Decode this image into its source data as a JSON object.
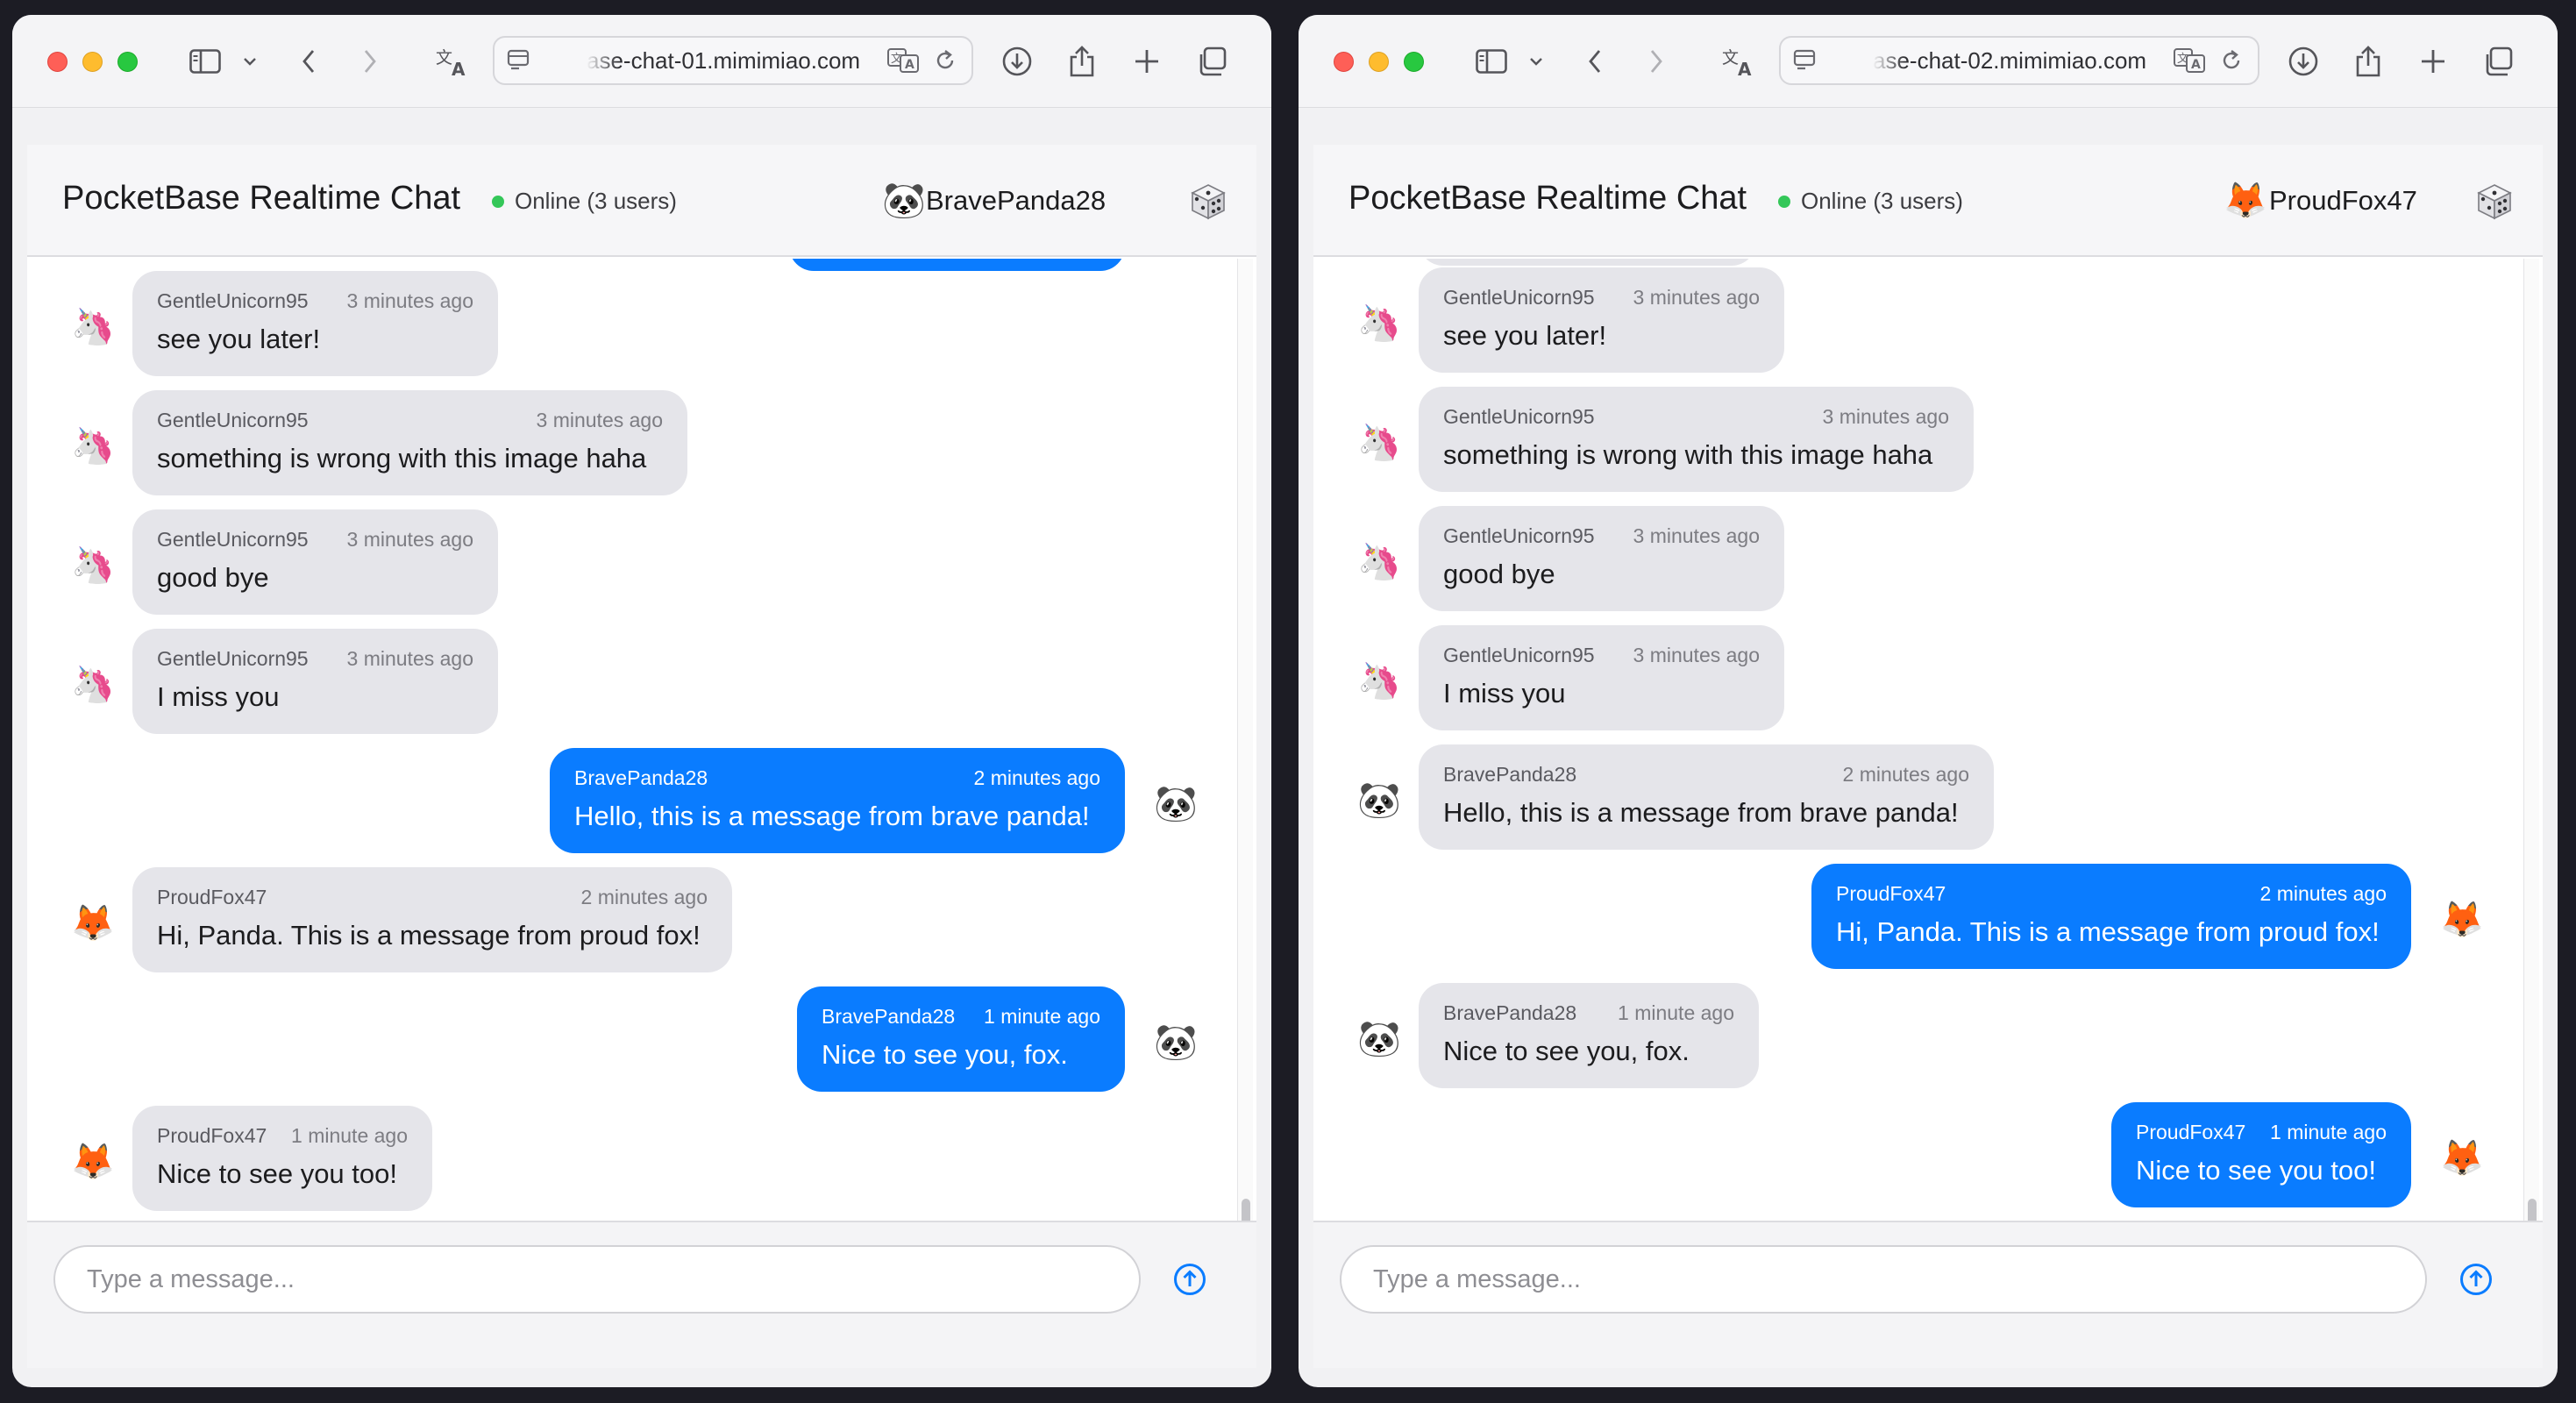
{
  "windows": [
    {
      "address": "ase-chat-01.mimimiao.com",
      "header": {
        "title": "PocketBase Realtime Chat",
        "status": "Online (3 users)",
        "user_avatar": "🐼",
        "username": "BravePanda28"
      },
      "messages": [
        {
          "author": "GentleUnicorn95",
          "time": "3 minutes ago",
          "text": "see you later!",
          "avatar": "🦄",
          "own": false
        },
        {
          "author": "GentleUnicorn95",
          "time": "3 minutes ago",
          "text": "something is wrong with this image haha",
          "avatar": "🦄",
          "own": false
        },
        {
          "author": "GentleUnicorn95",
          "time": "3 minutes ago",
          "text": "good bye",
          "avatar": "🦄",
          "own": false
        },
        {
          "author": "GentleUnicorn95",
          "time": "3 minutes ago",
          "text": "I miss you",
          "avatar": "🦄",
          "own": false
        },
        {
          "author": "BravePanda28",
          "time": "2 minutes ago",
          "text": "Hello, this is a message from brave panda!",
          "avatar": "🐼",
          "own": true
        },
        {
          "author": "ProudFox47",
          "time": "2 minutes ago",
          "text": "Hi, Panda. This is a message from proud fox!",
          "avatar": "🦊",
          "own": false
        },
        {
          "author": "BravePanda28",
          "time": "1 minute ago",
          "text": "Nice to see you, fox.",
          "avatar": "🐼",
          "own": true
        },
        {
          "author": "ProudFox47",
          "time": "1 minute ago",
          "text": "Nice to see you too!",
          "avatar": "🦊",
          "own": false
        }
      ],
      "composer": {
        "placeholder": "Type a message..."
      }
    },
    {
      "address": "ase-chat-02.mimimiao.com",
      "header": {
        "title": "PocketBase Realtime Chat",
        "status": "Online (3 users)",
        "user_avatar": "🦊",
        "username": "ProudFox47"
      },
      "messages": [
        {
          "author": "GentleUnicorn95",
          "time": "3 minutes ago",
          "text": "see you later!",
          "avatar": "🦄",
          "own": false
        },
        {
          "author": "GentleUnicorn95",
          "time": "3 minutes ago",
          "text": "something is wrong with this image haha",
          "avatar": "🦄",
          "own": false
        },
        {
          "author": "GentleUnicorn95",
          "time": "3 minutes ago",
          "text": "good bye",
          "avatar": "🦄",
          "own": false
        },
        {
          "author": "GentleUnicorn95",
          "time": "3 minutes ago",
          "text": "I miss you",
          "avatar": "🦄",
          "own": false
        },
        {
          "author": "BravePanda28",
          "time": "2 minutes ago",
          "text": "Hello, this is a message from brave panda!",
          "avatar": "🐼",
          "own": false
        },
        {
          "author": "ProudFox47",
          "time": "2 minutes ago",
          "text": "Hi, Panda. This is a message from proud fox!",
          "avatar": "🦊",
          "own": true
        },
        {
          "author": "BravePanda28",
          "time": "1 minute ago",
          "text": "Nice to see you, fox.",
          "avatar": "🐼",
          "own": false
        },
        {
          "author": "ProudFox47",
          "time": "1 minute ago",
          "text": "Nice to see you too!",
          "avatar": "🦊",
          "own": true
        }
      ],
      "composer": {
        "placeholder": "Type a message..."
      }
    }
  ],
  "colors": {
    "own_bubble": "#0a7cff",
    "other_bubble": "#e5e5ea",
    "online_dot": "#34c759",
    "accent": "#0a7cff"
  }
}
